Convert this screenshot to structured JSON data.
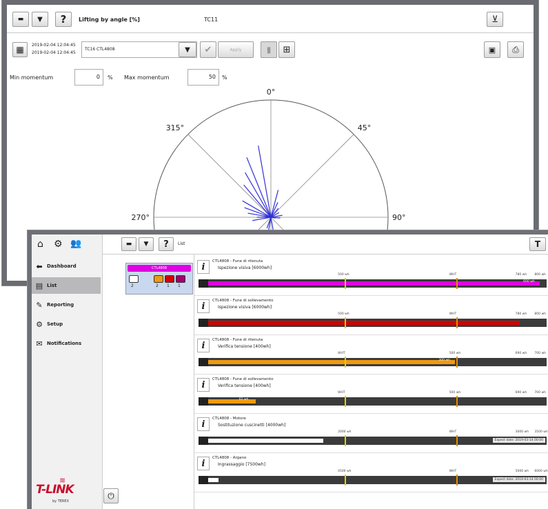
{
  "chart_window": {
    "title": "Lifting by angle [%]",
    "machine": "TC11",
    "date_start": "2019-02-04 12:04:45",
    "date_end": "2019-02-04 12:04:45",
    "machine_select": "TC16 CTL4808",
    "apply_label": "Apply",
    "min_label": "Min momentum",
    "min_value": "0",
    "max_label": "Max momentum",
    "max_value": "50",
    "unit": "%"
  },
  "chart_data": {
    "type": "polar",
    "angle_labels": [
      "0°",
      "45°",
      "90°",
      "270°",
      "315°"
    ],
    "series_color": "#2f2fd8",
    "rays_deg_length_pct": [
      [
        350,
        62
      ],
      [
        338,
        55
      ],
      [
        330,
        44
      ],
      [
        320,
        36
      ],
      [
        300,
        28
      ],
      [
        290,
        24
      ],
      [
        280,
        20
      ],
      [
        270,
        12
      ],
      [
        260,
        16
      ],
      [
        15,
        24
      ],
      [
        25,
        14
      ],
      [
        40,
        10
      ],
      [
        60,
        8
      ],
      [
        80,
        10
      ],
      [
        95,
        8
      ],
      [
        100,
        4
      ],
      [
        190,
        18
      ],
      [
        170,
        14
      ],
      [
        200,
        10
      ]
    ]
  },
  "list_window": {
    "header_label": "List",
    "group_label": "CTL4808",
    "group_counts": [
      "2",
      "2",
      "1",
      "1"
    ],
    "sidebar": [
      {
        "label": "Dashboard"
      },
      {
        "label": "List"
      },
      {
        "label": "Reporting"
      },
      {
        "label": "Setup"
      },
      {
        "label": "Notifications"
      }
    ],
    "brand": "T-LINK",
    "brand_sub": "by TEREX",
    "entries": [
      {
        "title": "CTL4808 - Fune di ritenuta",
        "subtitle": "Ispezione visiva [6000wh]",
        "fill_pct": 98,
        "fill_color": "#e000e0",
        "marks": [
          "500 wh",
          "WHT",
          "780 wh",
          "800 wh"
        ],
        "note": "600 wh"
      },
      {
        "title": "CTL4808 - Fune di sollevamento",
        "subtitle": "Ispezione visiva [6000wh]",
        "fill_pct": 92,
        "fill_color": "#d40000",
        "marks": [
          "500 wh",
          "WHT",
          "780 wh",
          "800 wh"
        ],
        "note": ""
      },
      {
        "title": "CTL4808 - Fune di ritenuta",
        "subtitle": "Verifica tensione [400wh]",
        "fill_pct": 73,
        "fill_color": "#f09a10",
        "marks": [
          "WHT",
          "500 wh",
          "690 wh",
          "700 wh"
        ],
        "note": "300 wh"
      },
      {
        "title": "CTL4808 - Fune di sollevamento",
        "subtitle": "Verifica tensione [400wh]",
        "fill_pct": 14,
        "fill_color": "#f09a10",
        "marks": [
          "WHT",
          "500 wh",
          "690 wh",
          "700 wh"
        ],
        "note": "62 wh"
      },
      {
        "title": "CTL4808 - Motore",
        "subtitle": "Sostituzione cuscinetti [4000wh]",
        "fill_pct": 34,
        "fill_color": "#ffffff",
        "marks": [
          "2000 wh",
          "WHT",
          "3000 wh",
          "3500 wh"
        ],
        "note": "Expect date: 2019-03-14 00:00"
      },
      {
        "title": "CTL4808 - Argano",
        "subtitle": "Ingrassaggio [7500wh]",
        "fill_pct": 3,
        "fill_color": "#ffffff",
        "marks": [
          "4500 wh",
          "WHT",
          "5000 wh",
          "6000 wh"
        ],
        "note": "Expect date: 2019-03-14 00:00"
      }
    ]
  }
}
